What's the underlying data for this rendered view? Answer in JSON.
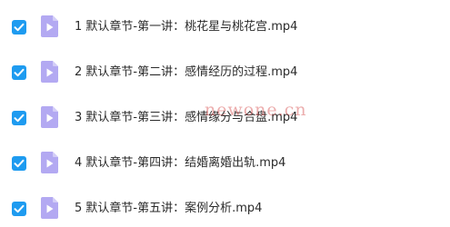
{
  "colors": {
    "checkbox": "#1e9bf0",
    "file_icon": "#b3a9f2",
    "file_icon_play": "#ffffff",
    "text": "#2b2b2b",
    "watermark": "#cd2828"
  },
  "files": [
    {
      "name": "1 默认章节-第一讲：桃花星与桃花宫.mp4",
      "checked": true,
      "icon": "video-file-icon"
    },
    {
      "name": "2 默认章节-第二讲：感情经历的过程.mp4",
      "checked": true,
      "icon": "video-file-icon"
    },
    {
      "name": "3 默认章节-第三讲：感情缘分与合盘.mp4",
      "checked": true,
      "icon": "video-file-icon"
    },
    {
      "name": "4 默认章节-第四讲：结婚离婚出轨.mp4",
      "checked": true,
      "icon": "video-file-icon"
    },
    {
      "name": "5 默认章节-第五讲：案例分析.mp4",
      "checked": true,
      "icon": "video-file-icon"
    }
  ],
  "watermark": {
    "text": "newone.cn"
  }
}
